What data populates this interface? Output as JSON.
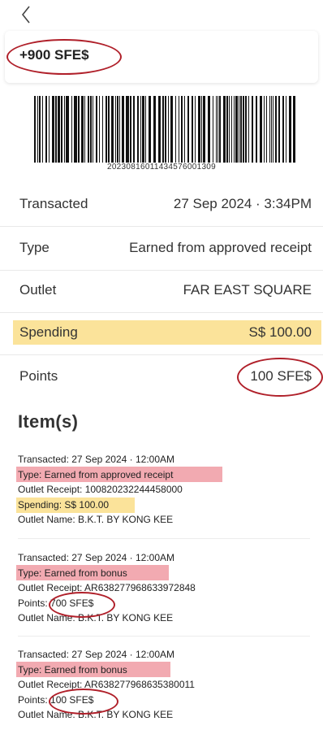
{
  "header": {
    "points_earned": "+900 SFE$"
  },
  "barcode": {
    "number": "20230816011434576001309"
  },
  "details": {
    "transacted_label": "Transacted",
    "transacted_value": "27 Sep 2024 · 3:34PM",
    "type_label": "Type",
    "type_value": "Earned from approved receipt",
    "outlet_label": "Outlet",
    "outlet_value": "FAR EAST SQUARE",
    "spending_label": "Spending",
    "spending_value": "S$ 100.00",
    "points_label": "Points",
    "points_value": "100 SFE$"
  },
  "items_title": "Item(s)",
  "items": [
    {
      "transacted": "Transacted: 27 Sep 2024 · 12:00AM",
      "type": "Type: Earned from approved receipt",
      "receipt": "Outlet Receipt: 100820232244458000",
      "amount": "Spending: S$ 100.00",
      "outlet_name": "Outlet Name: B.K.T. BY KONG KEE"
    },
    {
      "transacted": "Transacted: 27 Sep 2024 · 12:00AM",
      "type": "Type: Earned from bonus",
      "receipt": "Outlet Receipt: AR638277968633972848",
      "amount": "Points: 700 SFE$",
      "outlet_name": "Outlet Name: B.K.T. BY KONG KEE"
    },
    {
      "transacted": "Transacted: 27 Sep 2024 · 12:00AM",
      "type": "Type: Earned from bonus",
      "receipt": "Outlet Receipt: AR638277968635380011",
      "amount": "Points: 100 SFE$",
      "outlet_name": "Outlet Name: B.K.T. BY KONG KEE"
    }
  ],
  "colors": {
    "annotation_circle": "#b0202a",
    "highlight_yellow": "#fbe39a",
    "highlight_pink": "#f2aab1"
  }
}
